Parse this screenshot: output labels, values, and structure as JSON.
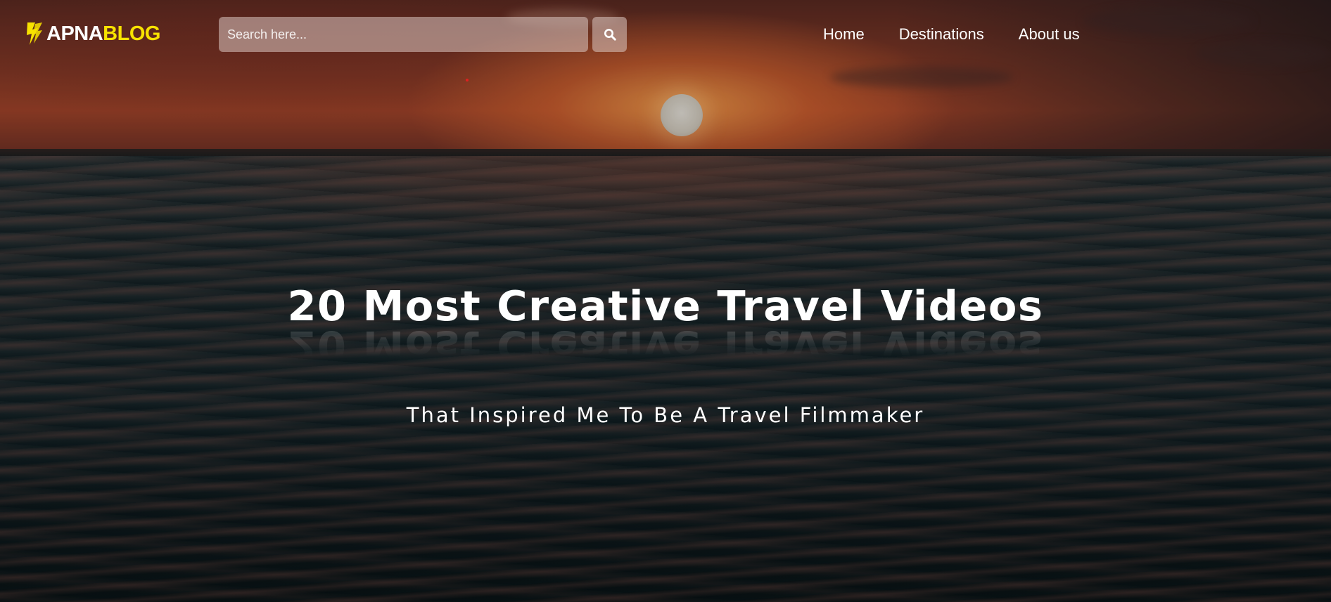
{
  "header": {
    "logo": {
      "part1": "APNA",
      "part2": "BLOG",
      "part1_color": "#ffffff",
      "part2_color": "#f7e200"
    },
    "search": {
      "placeholder": "Search here...",
      "value": "",
      "button_icon": "search-icon"
    },
    "nav": {
      "items": [
        {
          "label": "Home"
        },
        {
          "label": "Destinations"
        },
        {
          "label": "About us"
        }
      ]
    }
  },
  "hero": {
    "title": "20 Most Creative Travel Videos",
    "subtitle": "That Inspired Me To Be A Travel Filmmaker",
    "background": "sunset-over-ocean"
  },
  "colors": {
    "text": "#ffffff",
    "brand_yellow": "#f7e200"
  }
}
